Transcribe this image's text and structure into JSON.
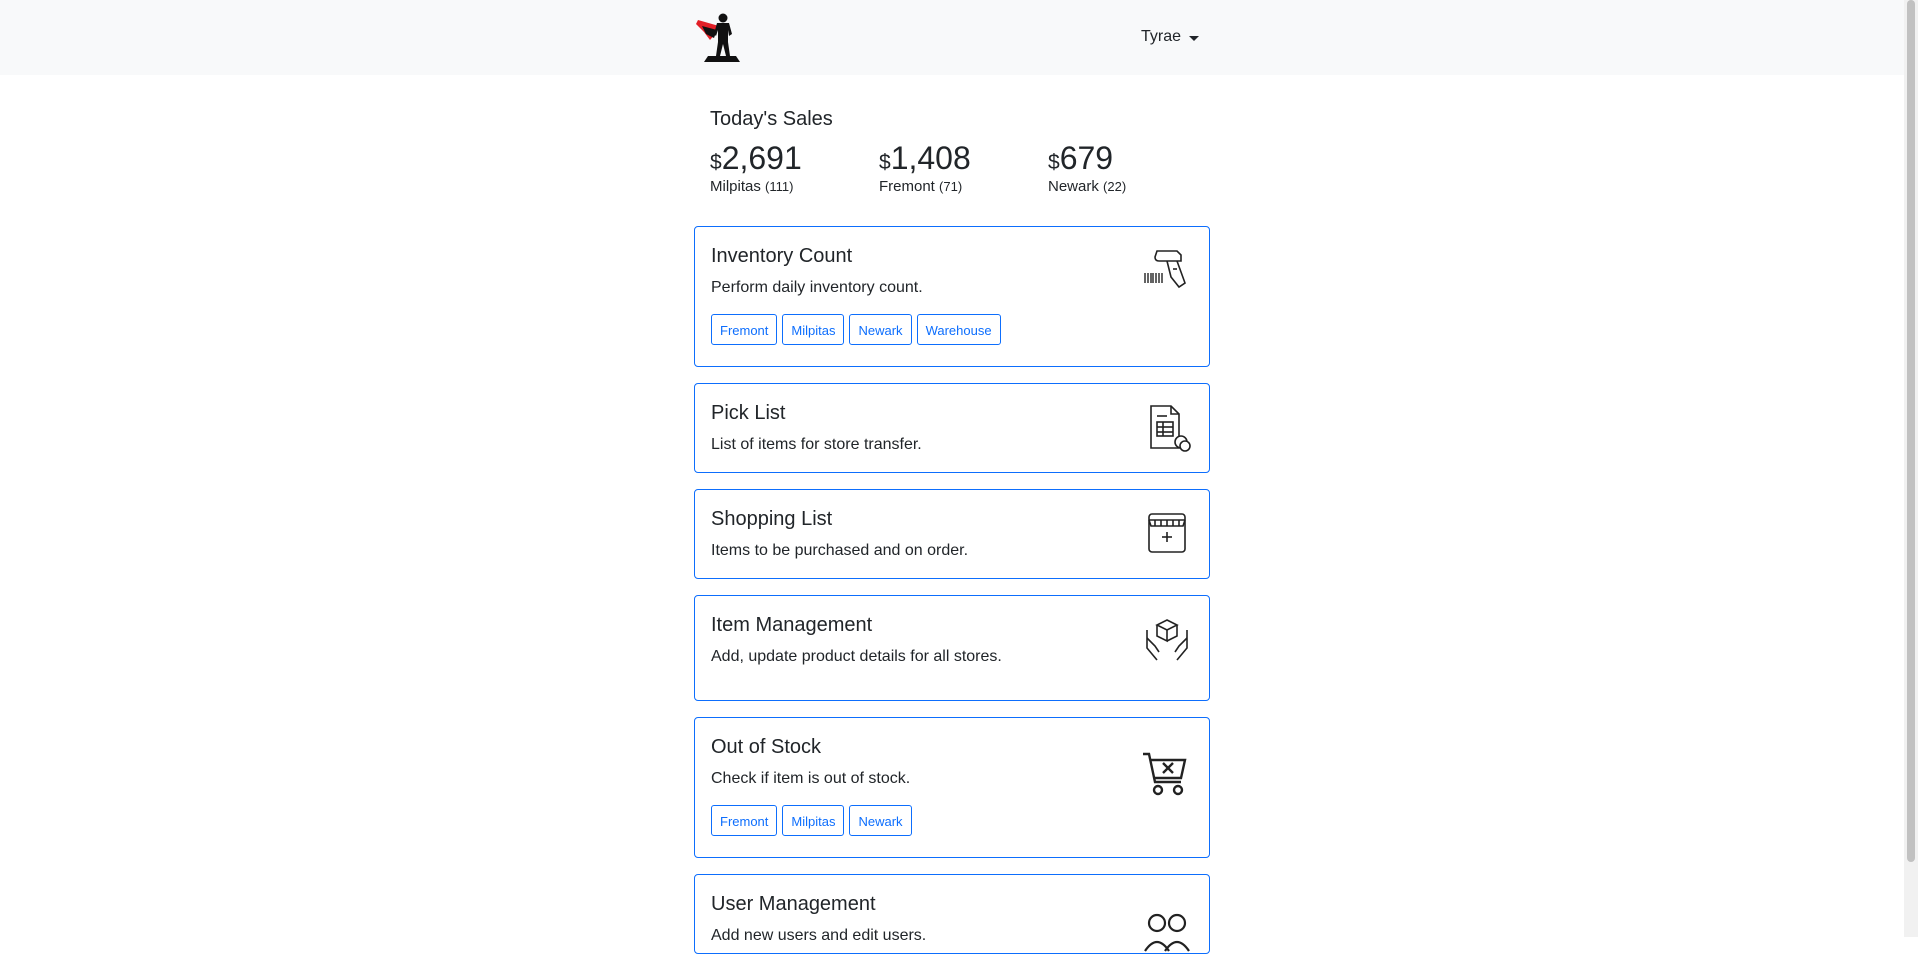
{
  "navbar": {
    "user_name": "Tyrae"
  },
  "sales": {
    "title": "Today's Sales",
    "currency_symbol": "$",
    "stores": [
      {
        "amount": "2,691",
        "name": "Milpitas",
        "count": "(111)"
      },
      {
        "amount": "1,408",
        "name": "Fremont",
        "count": "(71)"
      },
      {
        "amount": "679",
        "name": "Newark",
        "count": "(22)"
      }
    ]
  },
  "cards": [
    {
      "title": "Inventory Count",
      "description": "Perform daily inventory count.",
      "icon": "barcode-scanner-icon",
      "buttons": [
        "Fremont",
        "Milpitas",
        "Newark",
        "Warehouse"
      ]
    },
    {
      "title": "Pick List",
      "description": "List of items for store transfer.",
      "icon": "document-list-icon"
    },
    {
      "title": "Shopping List",
      "description": "Items to be purchased and on order.",
      "icon": "storefront-icon"
    },
    {
      "title": "Item Management",
      "description": "Add, update product details for all stores.",
      "icon": "hands-box-icon"
    },
    {
      "title": "Out of Stock",
      "description": "Check if item is out of stock.",
      "icon": "cart-x-icon",
      "buttons": [
        "Fremont",
        "Milpitas",
        "Newark"
      ]
    },
    {
      "title": "User Management",
      "description": "Add new users and edit users.",
      "icon": "users-icon"
    }
  ],
  "colors": {
    "primary": "#0d6efd",
    "navbar_bg": "#f8f9fa",
    "text": "#212529",
    "logo_cape": "#e21f26"
  }
}
